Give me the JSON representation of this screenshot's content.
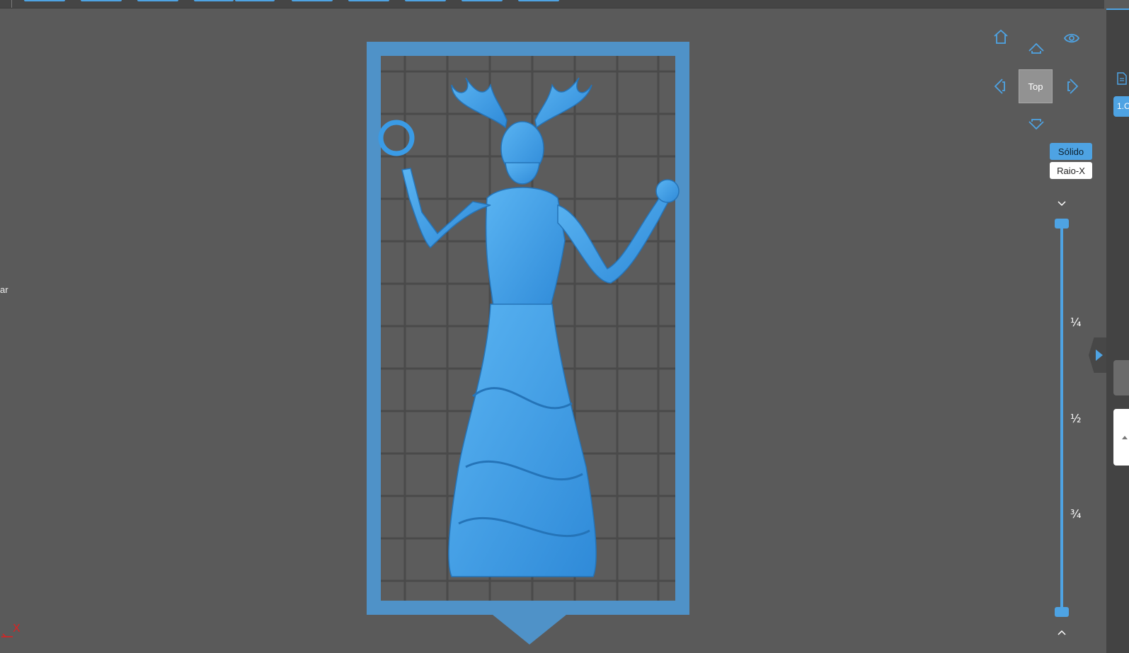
{
  "left_panel": {
    "label": "ar"
  },
  "axis": {
    "x_label": "X"
  },
  "view_controls": {
    "cube_label": "Top",
    "icons": [
      "home-icon",
      "eye-icon",
      "up-arrow-icon",
      "left-arrow-icon",
      "right-arrow-icon",
      "down-arrow-icon"
    ]
  },
  "render_mode": {
    "solid_label": "Sólido",
    "xray_label": "Raio-X",
    "active": "Sólido"
  },
  "layer_slider": {
    "ticks": [
      "¼",
      "½",
      "¾"
    ],
    "upper_value": 1.0,
    "lower_value": 0.0
  },
  "right_panel": {
    "tab_label": "1.C"
  },
  "colors": {
    "accent": "#4ea3e3",
    "background": "#5a5a5a",
    "model": "#3a9be6",
    "plate": "#4f92c8"
  }
}
